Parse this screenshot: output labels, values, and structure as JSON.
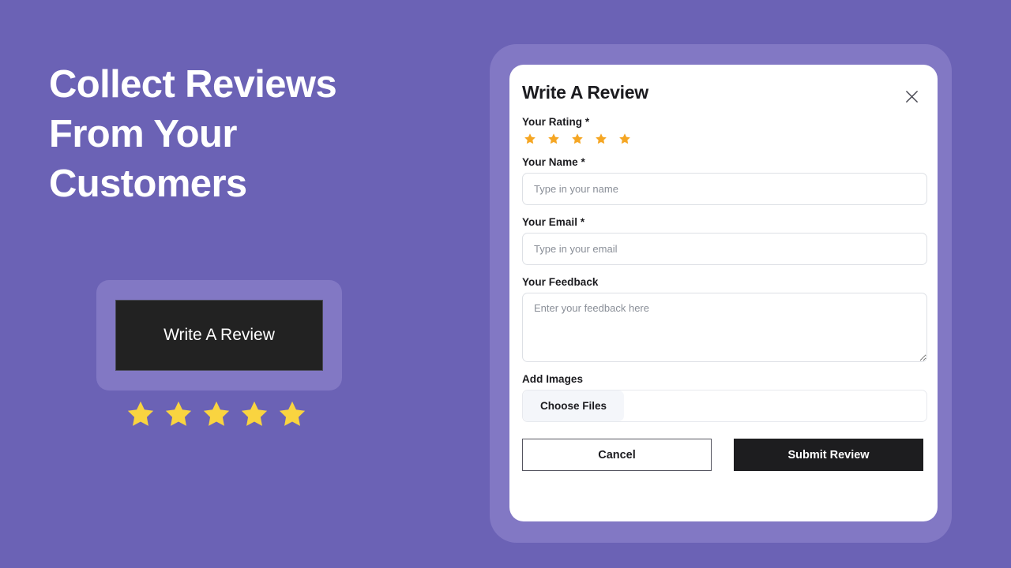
{
  "theme": {
    "background": "#6B62B5",
    "card_surface": "#8278C4",
    "dark": "#1D1D1F",
    "modal_star": "#F5A623",
    "hero_star": "#F9D440",
    "border": "#DDE0E5",
    "placeholder": "#8A8F98"
  },
  "promo": {
    "headline": "Collect Reviews From Your Customers",
    "cta_label": "Write A Review",
    "star_count": 5
  },
  "modal": {
    "title": "Write A Review",
    "close_icon": "close-icon",
    "rating": {
      "label": "Your Rating *",
      "star_count": 5,
      "selected": 5
    },
    "fields": [
      {
        "label": "Your Name *",
        "placeholder": "Type in your name",
        "value": ""
      },
      {
        "label": "Your Email *",
        "placeholder": "Type in your email",
        "value": ""
      }
    ],
    "feedback": {
      "label": "Your Feedback",
      "placeholder": "Enter your feedback here",
      "value": ""
    },
    "images": {
      "label": "Add Images",
      "button_label": "Choose Files",
      "selected_files": ""
    },
    "actions": {
      "cancel_label": "Cancel",
      "submit_label": "Submit Review"
    }
  }
}
